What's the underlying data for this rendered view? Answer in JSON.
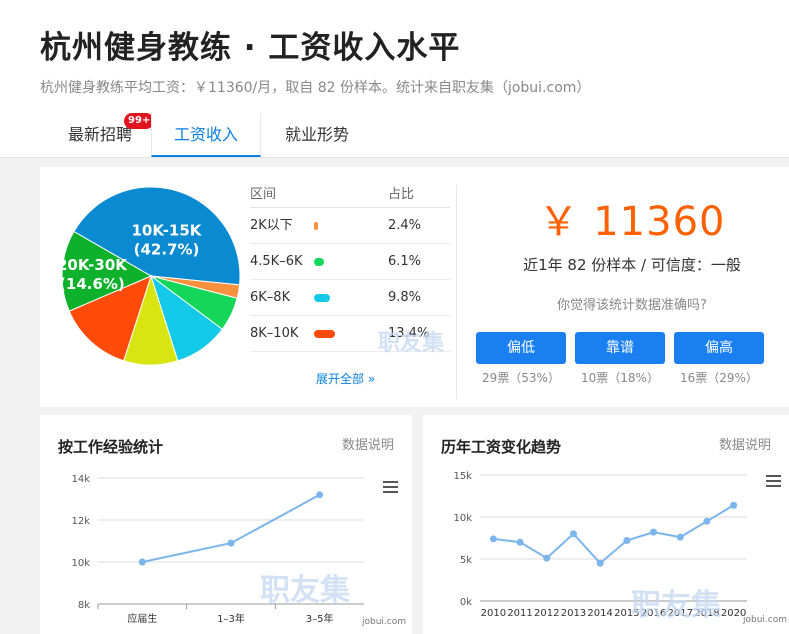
{
  "header": {
    "title": "杭州健身教练 · 工资收入水平",
    "subtitle": "杭州健身教练平均工资：￥11360/月，取自 82 份样本。统计来自职友集（jobui.com）",
    "tabs": [
      {
        "label": "最新招聘",
        "badge": "99+"
      },
      {
        "label": "工资收入"
      },
      {
        "label": "就业形势"
      }
    ]
  },
  "distribution": {
    "header_range": "区间",
    "header_ratio": "占比",
    "rows": [
      {
        "range": "2K以下",
        "ratio": "2.4%",
        "color": "#f7913d"
      },
      {
        "range": "4.5K–6K",
        "ratio": "6.1%",
        "color": "#14d659"
      },
      {
        "range": "6K–8K",
        "ratio": "9.8%",
        "color": "#14c8e8"
      },
      {
        "range": "8K–10K",
        "ratio": "13.4%",
        "color": "#ff4b0a"
      }
    ],
    "expand_label": "展开全部 »",
    "watermark": "职友集"
  },
  "summary": {
    "salary": "￥ 11360",
    "sample_info": "近1年 82 份样本 / 可信度：一般",
    "question": "你觉得该统计数据准确吗?",
    "votes": [
      {
        "label": "偏低",
        "count": "29票（53%）"
      },
      {
        "label": "靠谱",
        "count": "10票（18%）"
      },
      {
        "label": "偏高",
        "count": "16票（29%）"
      }
    ]
  },
  "experience_panel": {
    "title": "按工作经验统计",
    "note": "数据说明",
    "watermark": "职友集",
    "credit": "jobui.com"
  },
  "trend_panel": {
    "title": "历年工资变化趋势",
    "note": "数据说明",
    "watermark": "职友集",
    "credit": "jobui.com"
  },
  "chart_data": [
    {
      "type": "pie",
      "slices": [
        {
          "label": "10K-15K",
          "pct_label": "(42.7%)",
          "value": 42.7,
          "color": "#0a8ad0"
        },
        {
          "label": "2K以下",
          "value": 2.4,
          "color": "#f7913d"
        },
        {
          "label": "4.5K–6K",
          "value": 6.1,
          "color": "#14d659"
        },
        {
          "label": "6K–8K",
          "value": 9.8,
          "color": "#14c8e8"
        },
        {
          "label": "",
          "value": 9.7,
          "color": "#d8e511"
        },
        {
          "label": "8K–10K",
          "value": 13.4,
          "color": "#ff4b0a"
        },
        {
          "label": "20K-30K",
          "pct_label": "(14.6%)",
          "value": 14.6,
          "color": "#0db12c"
        }
      ]
    },
    {
      "type": "line",
      "categories": [
        "应届生",
        "1–3年",
        "3–5年"
      ],
      "values": [
        10000,
        10900,
        13200
      ],
      "ylim": [
        8000,
        14000
      ],
      "yticks": [
        "8k",
        "10k",
        "12k",
        "14k"
      ],
      "color": "#7cb5ec"
    },
    {
      "type": "line",
      "categories": [
        "2010",
        "2011",
        "2012",
        "2013",
        "2014",
        "2015",
        "2016",
        "2017",
        "2018",
        "2020"
      ],
      "values": [
        7400,
        7000,
        5100,
        8000,
        4500,
        7200,
        8200,
        7600,
        9500,
        11400
      ],
      "ylim": [
        0,
        15000
      ],
      "yticks": [
        "0k",
        "5k",
        "10k",
        "15k"
      ],
      "color": "#7cb5ec"
    }
  ]
}
